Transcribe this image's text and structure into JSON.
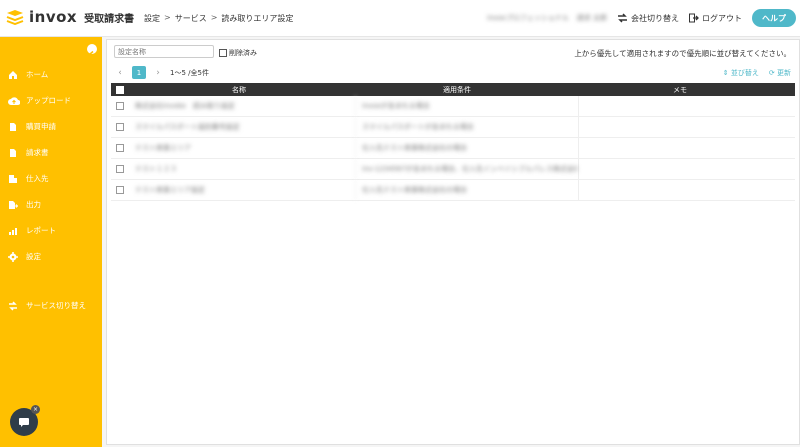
{
  "app": {
    "logo_text": "invox",
    "logo_sub": "受取請求書"
  },
  "breadcrumb": [
    "設定",
    "サービス",
    "読み取りエリア設定"
  ],
  "header": {
    "org_name": "invoxプロフェッショナル",
    "user_name": "請求 太郎",
    "switch_company": "会社切り替え",
    "logout": "ログアウト",
    "help": "ヘルプ"
  },
  "sidebar": {
    "items": [
      {
        "label": "ホーム",
        "icon": "home-icon"
      },
      {
        "label": "アップロード",
        "icon": "upload-cloud-icon"
      },
      {
        "label": "購買申請",
        "icon": "document-icon"
      },
      {
        "label": "請求書",
        "icon": "document-icon"
      },
      {
        "label": "仕入先",
        "icon": "building-icon"
      },
      {
        "label": "出力",
        "icon": "export-icon"
      },
      {
        "label": "レポート",
        "icon": "chart-icon"
      },
      {
        "label": "設定",
        "icon": "gear-icon"
      }
    ],
    "service_switch": "サービス切り替え"
  },
  "filter": {
    "placeholder": "設定名称",
    "deleted_label": "削除済み"
  },
  "notice": "上から優先して適用されますので優先順に並び替えてください。",
  "pager": {
    "current": "1",
    "range_text": "1〜5 /全5件"
  },
  "actions": {
    "sort": "並び替え",
    "refresh": "更新"
  },
  "table": {
    "headers": [
      "名称",
      "適用条件",
      "メモ"
    ],
    "rows": [
      {
        "name": "株式会社invoke　読み取り設定",
        "condition": "invoxが含まれる場合",
        "memo": ""
      },
      {
        "name": "スマイルパスポート識別番号設定",
        "condition": "スマイルパスポートが含まれる場合",
        "memo": ""
      },
      {
        "name": "テスト商事エリア",
        "condition": "仕入先テスト商事株式会社の場合",
        "memo": ""
      },
      {
        "name": "テスト１２３",
        "condition": "inv-1234567が含まれる場合、仕入先インベイシブルパレス株式会社",
        "memo": ""
      },
      {
        "name": "テスト商事エリア設定",
        "condition": "仕入先テスト商事株式会社の場合",
        "memo": ""
      }
    ]
  },
  "colors": {
    "sidebar": "#ffc000",
    "accent": "#4fb8c9",
    "table_header": "#333333",
    "chat": "#2f3d49"
  }
}
